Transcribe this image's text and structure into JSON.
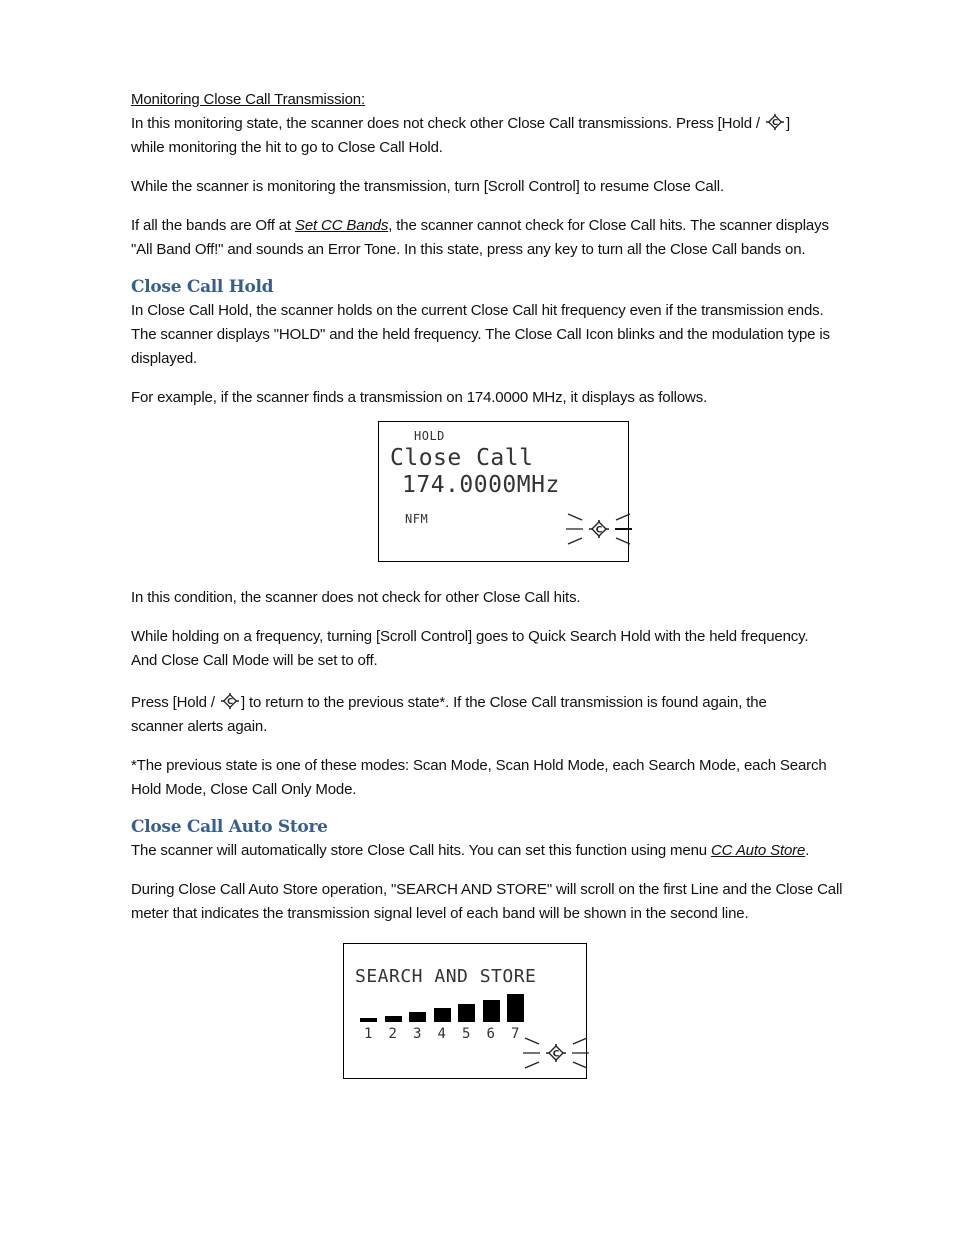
{
  "section_monitoring": {
    "title": "Monitoring Close Call Transmission:",
    "p1_a": "In this monitoring state, the scanner does not check other Close Call transmissions. Press [Hold / ",
    "p1_b": "]",
    "p1_c": "while monitoring the hit to go to Close Call Hold.",
    "p2": "While the scanner is monitoring the transmission, turn [Scroll Control] to resume Close Call.",
    "p3_a": "If all the bands are Off at ",
    "p3_link": "Set CC Bands",
    "p3_b": ", the scanner cannot check for Close Call hits. The scanner displays",
    "p3_c": "\"All Band Off!\" and sounds an Error Tone. In this state, press any key to turn all the Close Call bands on."
  },
  "section_hold": {
    "heading": "Close Call Hold",
    "p1_a": "In Close Call Hold, the scanner holds on the current Close Call hit frequency even if the transmission ends.",
    "p1_b": "The scanner displays \"HOLD\" and the held frequency. The Close Call Icon blinks and the modulation type is",
    "p1_c": "displayed.",
    "p2": "For example, if the scanner finds a transmission on 174.0000 MHz, it displays as follows.",
    "lcd": {
      "status": "HOLD",
      "title": "Close Call",
      "frequency": "174.0000MHz",
      "modulation": "NFM",
      "icon": "close-call-blinking-icon"
    },
    "p3": "In this condition, the scanner does not check for other Close Call hits.",
    "p4_a": "While holding on a frequency, turning [Scroll Control] goes to Quick Search Hold with the held frequency.",
    "p4_b": "And Close Call Mode will be set to off.",
    "p5_a": "Press [Hold / ",
    "p5_b": "] to return to the previous state*. If the Close Call transmission is found again, the",
    "p5_c": "scanner alerts again.",
    "p6_a": "*The previous state is one of these modes: Scan Mode, Scan Hold Mode, each Search Mode, each Search",
    "p6_b": "Hold Mode, Close Call Only Mode."
  },
  "section_autostore": {
    "heading": "Close Call Auto Store",
    "p1_a": "The scanner will automatically store Close Call hits. You can set this function using menu ",
    "p1_link": "CC Auto Store",
    "p1_b": ".",
    "p2_a": "During Close Call Auto Store operation, \"SEARCH AND STORE\" will scroll on the first Line and the Close Call",
    "p2_b": "meter that indicates the transmission signal level of each band will be shown in the second line.",
    "lcd": {
      "line1": "SEARCH AND STORE",
      "meter": [
        {
          "band": "1",
          "level": 0.14
        },
        {
          "band": "2",
          "level": 0.21
        },
        {
          "band": "3",
          "level": 0.36
        },
        {
          "band": "4",
          "level": 0.5
        },
        {
          "band": "5",
          "level": 0.64
        },
        {
          "band": "6",
          "level": 0.79
        },
        {
          "band": "7",
          "level": 1.0
        }
      ],
      "icon": "close-call-blinking-icon"
    }
  }
}
